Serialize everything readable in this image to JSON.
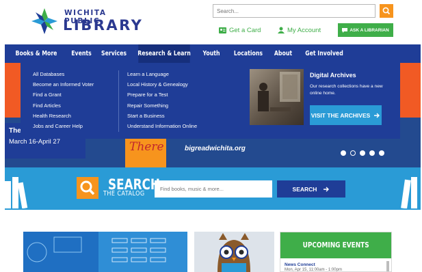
{
  "header": {
    "logo_top": "WICHITA PUBLIC",
    "logo_main": "LIBRARY",
    "search_placeholder": "Search...",
    "get_card": "Get a Card",
    "my_account": "My Account",
    "ask_librarian": "ASK A LIBRARIAN"
  },
  "nav": {
    "items": [
      "Books & More",
      "Events",
      "Services",
      "Research & Learn",
      "Youth",
      "Locations",
      "About",
      "Get Involved"
    ],
    "active": "Research & Learn"
  },
  "mega_menu": {
    "col1": [
      "All Databases",
      "Become an Informed Voter",
      "Find a Grant",
      "Find Articles",
      "Health Research",
      "Jobs and Career Help"
    ],
    "col2": [
      "Learn a Language",
      "Local History & Genealogy",
      "Prepare for a Test",
      "Repair Something",
      "Start a Business",
      "Understand Information Online"
    ],
    "archives_title": "Digital Archives",
    "archives_text": "Our research collections have a new online home.",
    "archives_button": "VISIT THE ARCHIVES"
  },
  "hero": {
    "title": "The",
    "dates": "March 16-April 27",
    "book_title": "There",
    "url": "bigreadwichita.org",
    "slides": 5,
    "active_slide": 2
  },
  "catalog": {
    "title": "SEARCH",
    "subtitle": "THE CATALOG",
    "placeholder": "Find books, music & more...",
    "button": "SEARCH"
  },
  "events": {
    "heading": "UPCOMING EVENTS",
    "first_title": "News Connect",
    "first_time": "Mon, Apr 15, 11:00am - 1:00pm"
  },
  "colors": {
    "navy": "#1f3d97",
    "green": "#3fae49",
    "orange": "#f7941d",
    "sky": "#2a9bd6"
  }
}
